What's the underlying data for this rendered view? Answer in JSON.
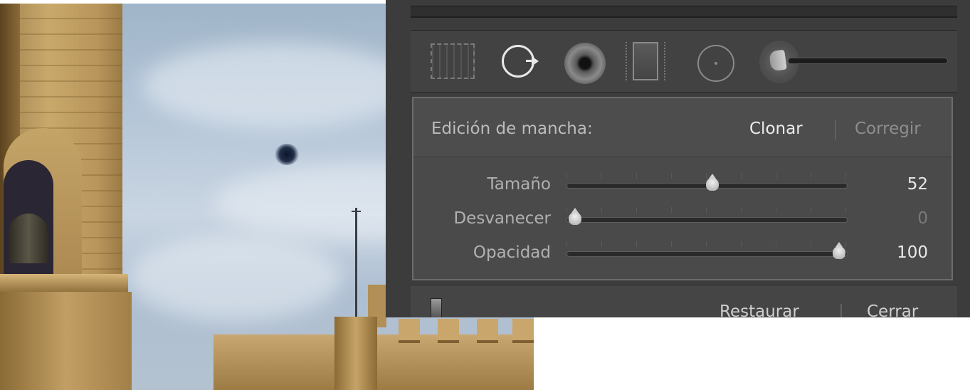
{
  "panel": {
    "tools": [
      {
        "name": "crop-overlay",
        "icon": "marquee-icon"
      },
      {
        "name": "spot-removal",
        "icon": "spot-removal-icon",
        "active": true
      },
      {
        "name": "red-eye",
        "icon": "red-eye-icon"
      },
      {
        "name": "graduated-filter",
        "icon": "graduated-filter-icon"
      },
      {
        "name": "radial-filter",
        "icon": "radial-filter-icon"
      },
      {
        "name": "adjustment-brush",
        "icon": "brush-icon"
      }
    ],
    "edit_label": "Edición de mancha:",
    "modes": {
      "clone": "Clonar",
      "heal": "Corregir",
      "selected": "Clonar"
    },
    "sliders": [
      {
        "label": "Tamaño",
        "value": "52",
        "level": 0.52
      },
      {
        "label": "Desvanecer",
        "value": "0",
        "level": 0.0
      },
      {
        "label": "Opacidad",
        "value": "100",
        "level": 1.0
      }
    ],
    "buttons": {
      "reset": "Restaurar",
      "close": "Cerrar"
    }
  },
  "colors": {
    "panel_bg": "#3c3c3c",
    "active_text": "#ececec",
    "inactive_text": "#8e8e8e"
  }
}
